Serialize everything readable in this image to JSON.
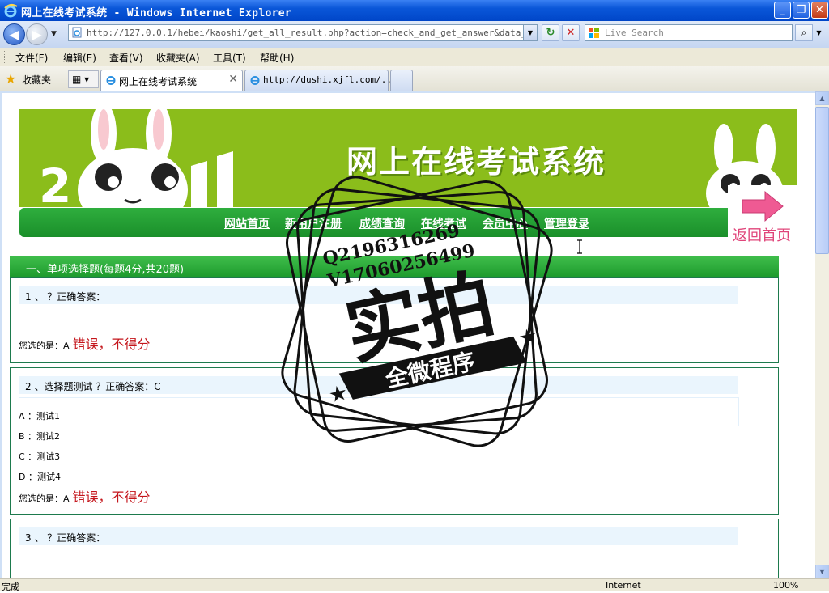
{
  "window": {
    "title": "网上在线考试系统 - Windows Internet Explorer",
    "minimize": "_",
    "maximize": "❐",
    "close": "✕"
  },
  "addressbar": {
    "url": "http://127.0.0.1/hebei/kaoshi/get_all_result.php?action=check_and_get_answer&data_transpor",
    "search_placeholder": "Live Search",
    "back_glyph": "◀",
    "forward_glyph": "▶",
    "refresh_glyph": "↻",
    "stop_glyph": "✕",
    "search_glyph": "⌕"
  },
  "menu": {
    "items": [
      "文件(F)",
      "编辑(E)",
      "查看(V)",
      "收藏夹(A)",
      "工具(T)",
      "帮助(H)"
    ]
  },
  "favorites": {
    "label": "收藏夹",
    "grid_glyph": "▦ ▾"
  },
  "tabs": [
    {
      "label": "网上在线考试系统",
      "close": "✕"
    },
    {
      "label": "http://dushi.xjfl.com/..."
    }
  ],
  "site": {
    "banner_title": "网上在线考试系统",
    "nav": [
      "网站首页",
      "新用户注册",
      "成绩查询",
      "在线考试",
      "会员中心",
      "管理登录"
    ],
    "return_home": "返回首页"
  },
  "section": {
    "title": "一、单项选择题(每题4分,共20题)"
  },
  "questions": [
    {
      "title": "1 、 ？正确答案：",
      "answer_prefix": "您选的是：A",
      "answer_result": "错误，不得分"
    },
    {
      "title": "2 、选择题测试 ？正确答案：C",
      "options": [
        "A ：测试1",
        "B ：测试2",
        "C ：测试3",
        "D ：测试4"
      ],
      "answer_prefix": "您选的是：A",
      "answer_result": "错误，不得分"
    },
    {
      "title": "3 、 ？正确答案："
    }
  ],
  "stamp": {
    "line1": "Q2196316269",
    "line2": "V17060256499",
    "main": "实拍",
    "ribbon": "全微程序"
  },
  "statusbar": {
    "status": "完成",
    "zone": "Internet",
    "zoom": "100%"
  },
  "colors": {
    "banner_green": "#8bbd1b",
    "nav_green": "#1f9a2d",
    "error_red": "#c4151b",
    "return_pink": "#e0457a"
  }
}
